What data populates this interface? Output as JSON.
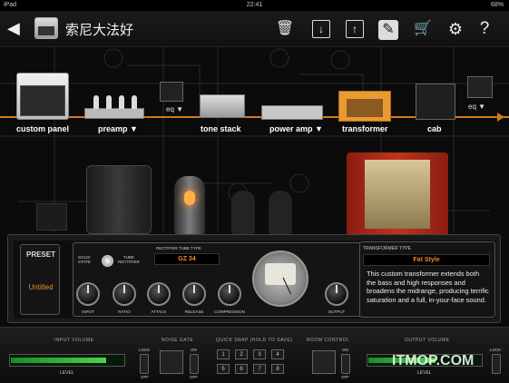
{
  "status": {
    "carrier": "iPad",
    "time": "22:41",
    "battery": "68%"
  },
  "toolbar": {
    "title": "索尼大法好",
    "help": "?"
  },
  "chain": {
    "modules": [
      {
        "label": "custom panel"
      },
      {
        "label": "preamp ▼"
      },
      {
        "label": "tone stack"
      },
      {
        "label": "power amp ▼"
      },
      {
        "label": "transformer"
      },
      {
        "label": "cab"
      }
    ],
    "eq_labels": [
      "eq ▼",
      "eq ▼"
    ]
  },
  "panel": {
    "preset_title": "PRESET",
    "preset_name": "Untitled",
    "solid_state": "SOLID\nSTATE",
    "tube_rectifier": "TUBE\nRECTIFIER",
    "rectifier_title": "RECTIFIER TUBE TYPE",
    "rectifier_value": "GZ 34",
    "knobs": [
      "INPUT",
      "RATIO",
      "ATTACK",
      "RELEASE",
      "COMPRESSION"
    ],
    "output_label": "OUTPUT",
    "transformer_title": "TRANSFORMER TYPE",
    "transformer_value": "Fat Style",
    "transformer_desc": "This custom transformer extends both the bass and high responses and broadens the midrange, producing terrific saturation and a full, in-your-face sound."
  },
  "bottom": {
    "input_volume": "INPUT VOLUME",
    "noise_gate": "NOISE GATE",
    "quick_snap": "QUICK SNAP (HOLD TO SAVE)",
    "room_control": "ROOM CONTROL",
    "output_volume": "OUTPUT VOLUME",
    "level": "LEVEL",
    "lock": "LOCK",
    "on": "ON",
    "off": "OFF",
    "snaps": [
      "1",
      "2",
      "3",
      "4",
      "5",
      "6",
      "7",
      "8"
    ],
    "input_level_fraction": 0.85,
    "output_level_fraction": 0.6
  },
  "watermark": "ITMOP.COM",
  "colors": {
    "accent": "#f08a24",
    "signal": "#d07a1c",
    "meter": "#4ed34a"
  }
}
